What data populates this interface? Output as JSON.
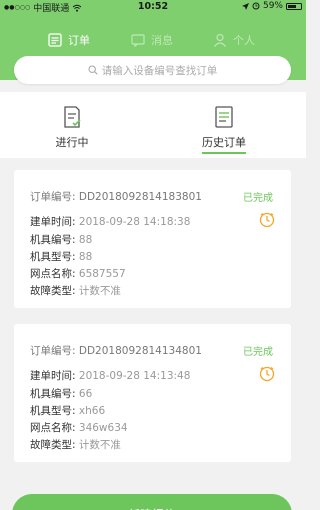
{
  "status_bar": {
    "carrier": "中国联通",
    "time": "10:52",
    "battery": "59%"
  },
  "tabs": [
    {
      "label": "订单",
      "icon": "order-list-icon",
      "active": true
    },
    {
      "label": "消息",
      "icon": "message-icon",
      "active": false
    },
    {
      "label": "个人",
      "icon": "person-icon",
      "active": false
    }
  ],
  "search": {
    "placeholder": "请输入设备编号查找订单",
    "icon": "search-icon"
  },
  "order_tabs": [
    {
      "label": "进行中",
      "icon": "in-progress-doc-icon",
      "active": false
    },
    {
      "label": "历史订单",
      "icon": "history-doc-icon",
      "active": true
    }
  ],
  "labels": {
    "order_no": "订单编号:",
    "create_time": "建单时间:",
    "machine_no": "机具编号:",
    "machine_model": "机具型号:",
    "outlet": "网点名称:",
    "fault": "故障类型:"
  },
  "orders": [
    {
      "order_no": "DD2018092814183801",
      "status": "已完成",
      "create_time": "2018-09-28 14:18:38",
      "machine_no": "88",
      "machine_model": "88",
      "outlet": "6587557",
      "fault": "计数不准"
    },
    {
      "order_no": "DD2018092814134801",
      "status": "已完成",
      "create_time": "2018-09-28 14:13:48",
      "machine_no": "66",
      "machine_model": "xh66",
      "outlet": "346w634",
      "fault": "计数不准"
    }
  ],
  "bottom_button": {
    "label": "新建报修"
  },
  "colors": {
    "header": "#7fcf6f",
    "accent": "#6cc65b",
    "background": "#f1f1f1",
    "orange": "#f5a623"
  }
}
